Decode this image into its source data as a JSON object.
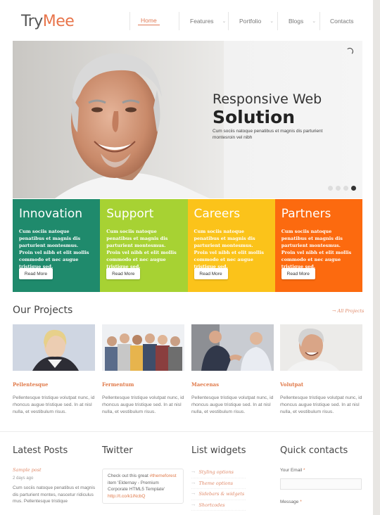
{
  "logo": {
    "part1": "Try",
    "part2": "Mee"
  },
  "nav": [
    {
      "label": "Home",
      "has_dropdown": false,
      "active": true
    },
    {
      "label": "Features",
      "has_dropdown": true
    },
    {
      "label": "Portfolio",
      "has_dropdown": true
    },
    {
      "label": "Blogs",
      "has_dropdown": true
    },
    {
      "label": "Contacts",
      "has_dropdown": false
    }
  ],
  "slider": {
    "title_line1": "Responsive Web",
    "title_line2": "Solution",
    "text": "Cum sociis natoque penatibus et magnis dis parturient montesroin vel nibh",
    "dots": 4,
    "active_dot": 4
  },
  "features": [
    {
      "title": "Innovation",
      "text": "Cum sociis natoque penatibus et magnis dis parturient montesmus. Proin vel nibh et elit mollis commodo et nec augue tristique sed.",
      "button": "Read More",
      "color": "#1f8a6c"
    },
    {
      "title": "Support",
      "text": "Cum sociis natoque penatibus et magnis dis parturient montesmus. Proin vel nibh et elit mollis commodo et nec augue tristique sed.",
      "button": "Read More",
      "color": "#a7d233"
    },
    {
      "title": "Careers",
      "text": "Cum sociis natoque penatibus et magnis dis parturient montesmus. Proin vel nibh et elit mollis commodo et nec augue tristique sed.",
      "button": "Read More",
      "color": "#fbc31a"
    },
    {
      "title": "Partners",
      "text": "Cum sociis natoque penatibus et magnis dis parturient montesmus. Proin vel nibh et elit mollis commodo et nec augue tristique sed.",
      "button": "Read More",
      "color": "#fc6a0f"
    }
  ],
  "projects": {
    "title": "Our Projects",
    "all_link": "→ All Projects",
    "items": [
      {
        "name": "Pellentesque",
        "text": "Pellentesque tristique volutpat nunc, id rhoncus augue tristique sed. In at nisl nulla, et vestibulum risus."
      },
      {
        "name": "Fermentum",
        "text": "Pellentesque tristique volutpat nunc, id rhoncus augue tristique sed. In at nisl nulla, et vestibulum risus."
      },
      {
        "name": "Maecenas",
        "text": "Pellentesque tristique volutpat nunc, id rhoncus augue tristique sed. In at nisl nulla, et vestibulum risus."
      },
      {
        "name": "Volutpat",
        "text": "Pellentesque tristique volutpat nunc, id rhoncus augue tristique sed. In at nisl nulla, et vestibulum risus."
      }
    ]
  },
  "latest_posts": {
    "title": "Latest Posts",
    "post_title": "Sample post",
    "post_date": "2 days ago",
    "post_text": "Cum sociis natoque penatibus et magnis dis parturient montes, nascetur ridiculus mus. Pellentesque tristique"
  },
  "twitter": {
    "title": "Twitter",
    "tweet_pre": "Check out this great ",
    "tweet_tag": "#themeforest",
    "tweet_mid": " item 'Eldernay - Premium Corporate HTML5 Template' ",
    "tweet_link": "http://t.co/k1iNcbQ"
  },
  "list_widgets": {
    "title": "List widgets",
    "items": [
      "Styling options",
      "Theme options",
      "Sidebars & widgets",
      "Shortcodes"
    ]
  },
  "quick_contacts": {
    "title": "Quick contacts",
    "email_label": "Your Email",
    "message_label": "Message",
    "required": "*"
  }
}
